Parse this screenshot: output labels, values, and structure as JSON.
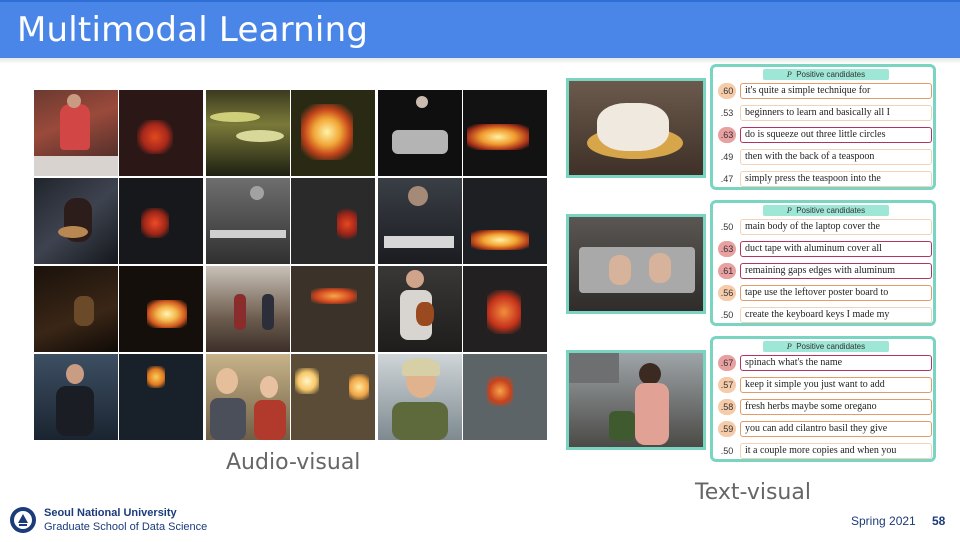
{
  "slide": {
    "title": "Multimodal Learning",
    "audio_visual_caption": "Audio-visual",
    "text_visual_caption": "Text-visual"
  },
  "text_visual": {
    "header_label": "Positive candidates",
    "header_symbol": "P",
    "groups": [
      {
        "scene": "cake-frosting",
        "rows": [
          {
            "score": ".60",
            "text": "it's quite a simple technique for",
            "level": "warm"
          },
          {
            "score": ".53",
            "text": "beginners to learn and basically all I",
            "level": "cool"
          },
          {
            "score": ".63",
            "text": "do is squeeze out three little circles",
            "level": "hot"
          },
          {
            "score": ".49",
            "text": "then with the back of a teaspoon",
            "level": "cool"
          },
          {
            "score": ".47",
            "text": "simply press the teaspoon into the",
            "level": "cool"
          }
        ]
      },
      {
        "scene": "laptop-taping",
        "rows": [
          {
            "score": ".50",
            "text": "main body of the laptop cover the",
            "level": "cool"
          },
          {
            "score": ".63",
            "text": "duct tape with aluminum cover all",
            "level": "hot"
          },
          {
            "score": ".61",
            "text": "remaining gaps edges with aluminum",
            "level": "hot"
          },
          {
            "score": ".56",
            "text": "tape use the leftover poster board to",
            "level": "warm"
          },
          {
            "score": ".50",
            "text": "create the keyboard keys I made my",
            "level": "cool"
          }
        ]
      },
      {
        "scene": "kitchen-cooking",
        "rows": [
          {
            "score": ".67",
            "text": "spinach what's the name",
            "level": "hot"
          },
          {
            "score": ".57",
            "text": "keep it simple you just want to add",
            "level": "warm"
          },
          {
            "score": ".58",
            "text": "fresh herbs maybe some oregano",
            "level": "warm"
          },
          {
            "score": ".59",
            "text": "you can add cilantro basil they give",
            "level": "warm"
          },
          {
            "score": ".50",
            "text": "it a couple more copies and when you",
            "level": "cool"
          }
        ]
      }
    ]
  },
  "footer": {
    "university": "Seoul National University",
    "school": "Graduate School of Data Science",
    "term": "Spring 2021",
    "page_number": "58"
  },
  "colors": {
    "title_bar": "#4a86e8",
    "panel_border": "#79d4c2",
    "hot_border": "#b3325e",
    "warm_border": "#e59a6a",
    "footer_text": "#1b3b7a"
  }
}
